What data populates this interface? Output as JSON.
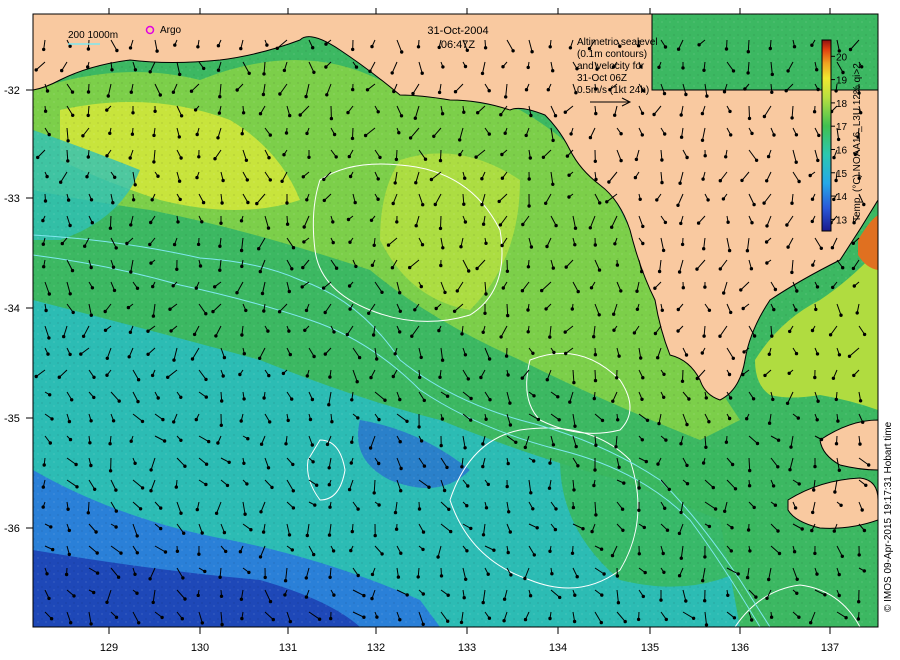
{
  "header": {
    "date": "31-Oct-2004",
    "time": "06:47Z"
  },
  "legend": {
    "scale_label": "200  1000m",
    "argo_label": "Argo",
    "argo_color": "#e000e0"
  },
  "velocity_note": {
    "lines": [
      "Altimetric sealevel",
      "(0.1m contours)",
      "and velocity for",
      "31-Oct 06Z",
      "0.5m/s (1kt 24h)"
    ]
  },
  "colorbar": {
    "title": "Temp. (°C) NOAA16_L3U 12% qi>2",
    "ticks": [
      "13",
      "14",
      "15",
      "16",
      "17",
      "18",
      "19",
      "20"
    ],
    "min": 12.5,
    "max": 20.7
  },
  "axes": {
    "lon_ticks": [
      "129",
      "130",
      "131",
      "132",
      "133",
      "134",
      "135",
      "136",
      "137"
    ],
    "lat_ticks": [
      "-32",
      "-33",
      "-34",
      "-35",
      "-36"
    ]
  },
  "credit": "© IMOS 09-Apr-2015 19:17:31 Hobart time",
  "colors": {
    "land": "#f9c9a0",
    "warm": "#c8e83a",
    "mid": "#4cc15a",
    "cool": "#2cbcb0",
    "cold": "#2a58c8"
  }
}
